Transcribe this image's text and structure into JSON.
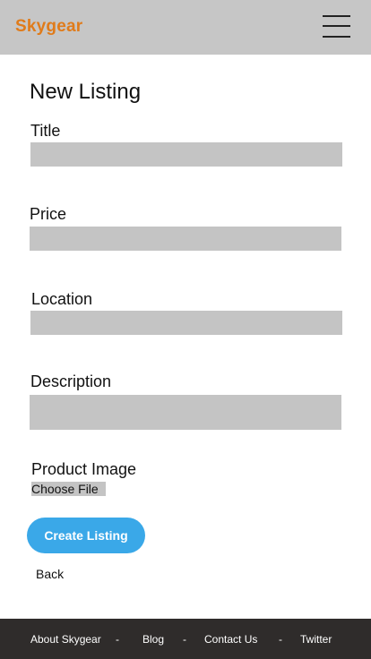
{
  "header": {
    "brand": "Skygear",
    "menu_icon": "hamburger-menu-icon"
  },
  "page": {
    "title": "New Listing"
  },
  "form": {
    "title_label": "Title",
    "title_value": "",
    "price_label": "Price",
    "price_value": "",
    "location_label": "Location",
    "location_value": "",
    "description_label": "Description",
    "description_value": "",
    "image_label": "Product Image",
    "file_button": "Choose File",
    "submit_label": "Create Listing",
    "back_label": "Back"
  },
  "footer": {
    "links": [
      "About Skygear",
      "Blog",
      "Contact Us",
      "Twitter"
    ],
    "separator": "-"
  },
  "colors": {
    "brand": "#e07b1a",
    "header_bg": "#c6c6c6",
    "field_bg": "#c4c4c4",
    "primary_button": "#3aa8e8",
    "footer_bg": "#2f2c2b"
  }
}
